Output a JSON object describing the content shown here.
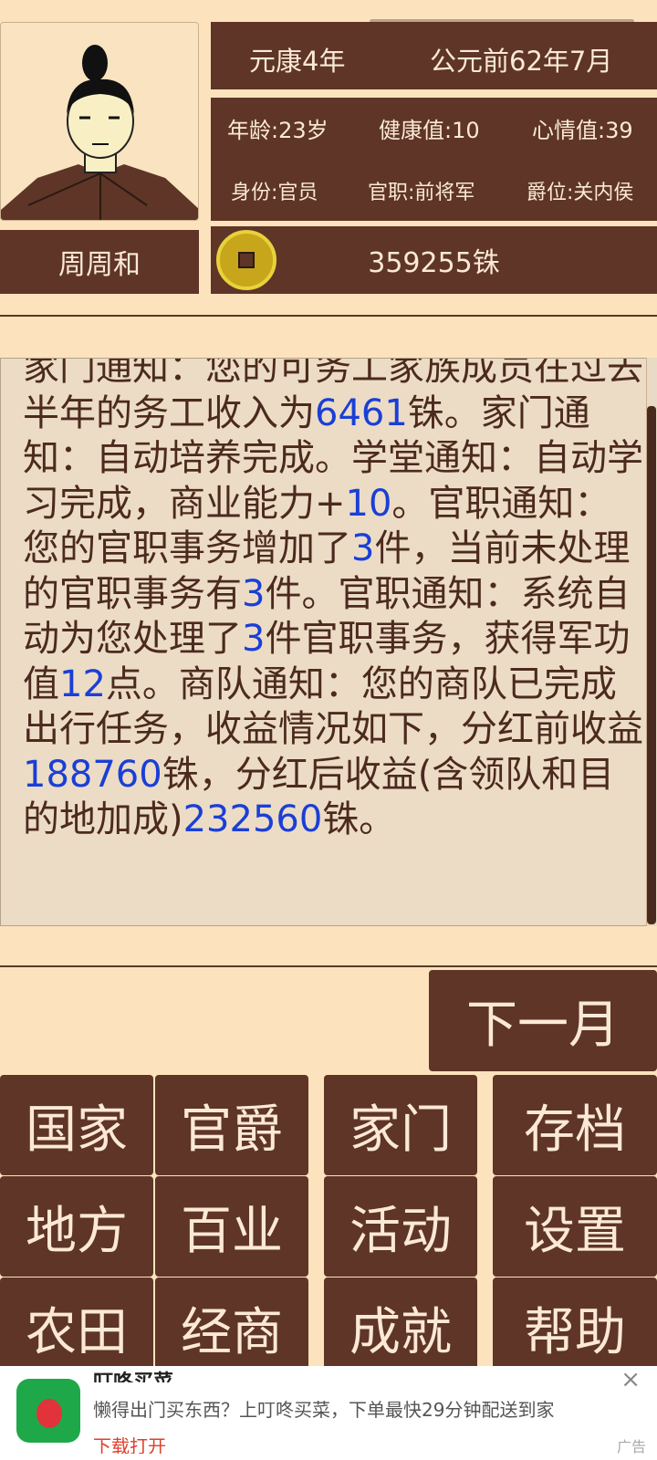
{
  "header": {
    "era": "元康4年",
    "date": "公元前62年7月",
    "age": "年龄:23岁",
    "health": "健康值:10",
    "mood": "心情值:39",
    "identity": "身份:官员",
    "office": "官职:前将军",
    "rank": "爵位:关内侯",
    "name": "周周和",
    "money": "359255铢"
  },
  "log": [
    {
      "t": "家门通知：您的可务工家族成员在"
    },
    {
      "t": "过去半年的务工收入为"
    },
    {
      "n": "6461"
    },
    {
      "t": "铢。"
    },
    {
      "t": "家门通知：自动培养完成。"
    },
    {
      "t": "学堂通知：自动学习完成，商业能力+"
    },
    {
      "n": "10"
    },
    {
      "t": "。"
    },
    {
      "t": "官职通知：您的官职事务增加了"
    },
    {
      "n": "3"
    },
    {
      "t": "件，当前未处理的官职事务有"
    },
    {
      "n": "3"
    },
    {
      "t": "件。"
    },
    {
      "t": "官职通知：系统自动为您处理了"
    },
    {
      "n": "3"
    },
    {
      "t": "件官职事务，获得军功值"
    },
    {
      "n": "12"
    },
    {
      "t": "点。"
    },
    {
      "t": "商队通知：您的商队已完成出行任务，收益情况如下，分红前收益"
    },
    {
      "n": "188760"
    },
    {
      "t": "铢，分红后收益(含领队和目的地加成)"
    },
    {
      "n": "232560"
    },
    {
      "t": "铢。"
    }
  ],
  "buttons": {
    "next": "下一月",
    "grid": [
      "国家",
      "官爵",
      "家门",
      "存档",
      "地方",
      "百业",
      "活动",
      "设置",
      "农田",
      "经商",
      "成就",
      "帮助"
    ]
  },
  "ad": {
    "title": "叮咚买菜",
    "desc": "懒得出门买东西？上叮咚买菜，下单最快29分钟配送到家",
    "link": "下载打开",
    "tag": "广告",
    "close": "×"
  }
}
